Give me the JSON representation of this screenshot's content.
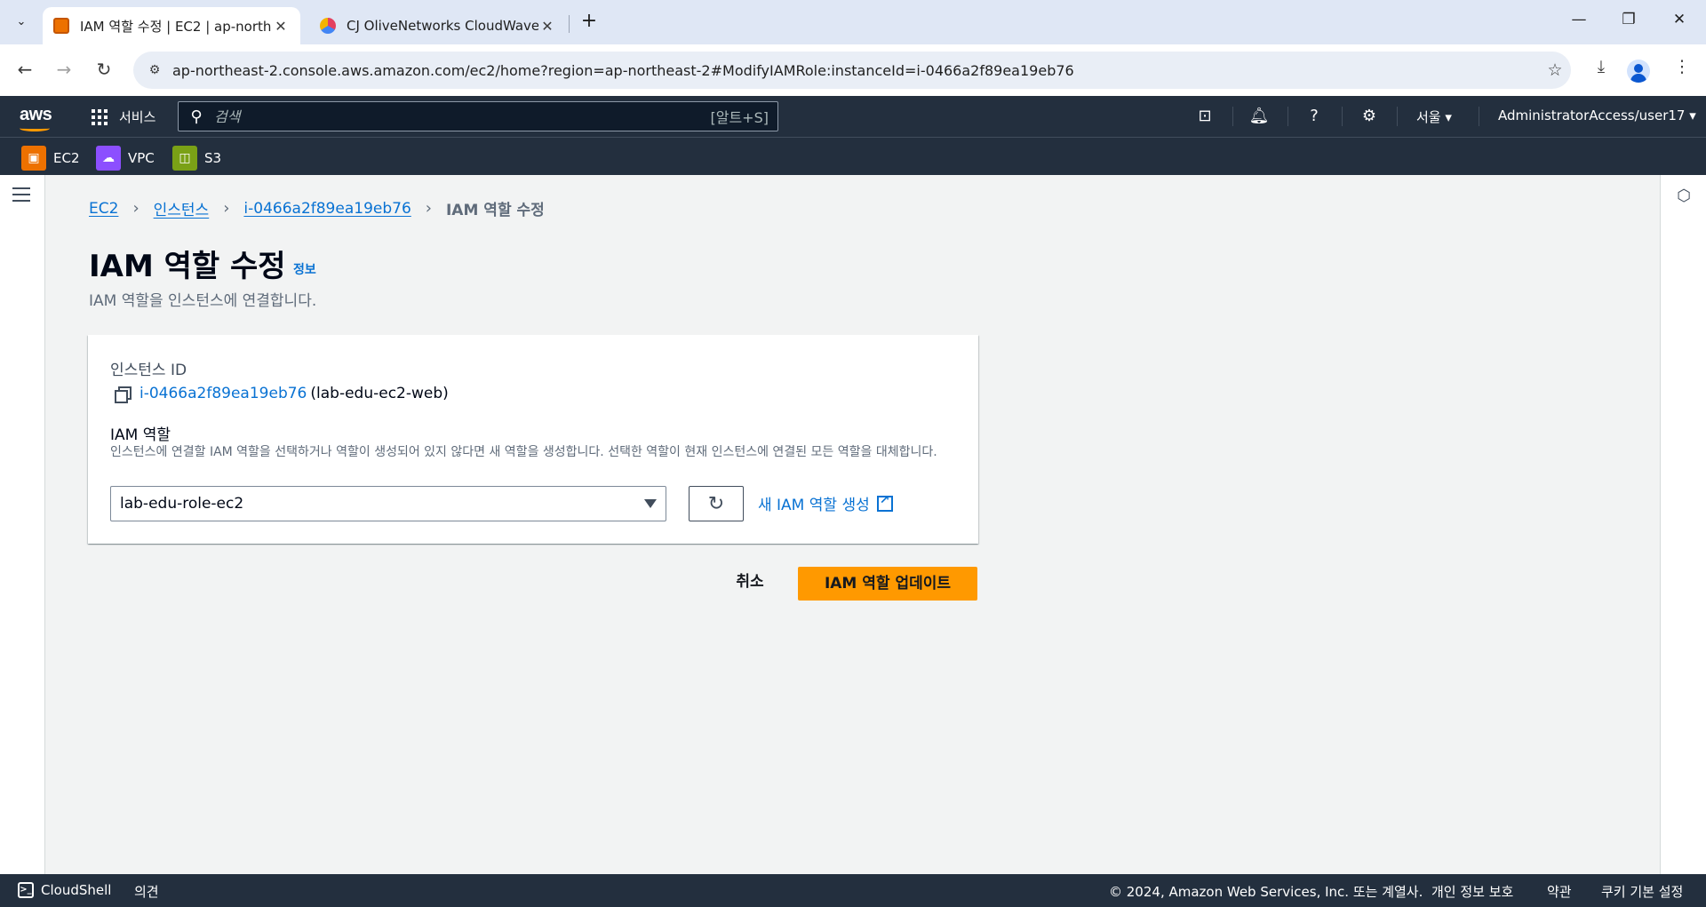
{
  "browser": {
    "tabs": [
      {
        "title": "IAM 역할 수정 | EC2 | ap-northeast-2"
      },
      {
        "title": "CJ OliveNetworks CloudWave"
      }
    ],
    "url": "ap-northeast-2.console.aws.amazon.com/ec2/home?region=ap-northeast-2#ModifyIAMRole:instanceId=i-0466a2f89ea19eb76"
  },
  "aws_header": {
    "logo": "aws",
    "services_label": "서비스",
    "search_placeholder": "검색",
    "search_shortcut": "[알트+S]",
    "region": "서울",
    "account": "AdministratorAccess/user17",
    "favorites": [
      {
        "label": "EC2",
        "color": "#ed7100"
      },
      {
        "label": "VPC",
        "color": "#8c4fff"
      },
      {
        "label": "S3",
        "color": "#7aa116"
      }
    ]
  },
  "breadcrumb": {
    "items": [
      "EC2",
      "인스턴스",
      "i-0466a2f89ea19eb76"
    ],
    "current": "IAM 역할 수정"
  },
  "page": {
    "title": "IAM 역할 수정",
    "info": "정보",
    "description": "IAM 역할을 인스턴스에 연결합니다."
  },
  "form": {
    "instance_label": "인스턴스 ID",
    "instance_id": "i-0466a2f89ea19eb76",
    "instance_name": "(lab-edu-ec2-web)",
    "role_label": "IAM 역할",
    "role_description": "인스턴스에 연결할 IAM 역할을 선택하거나 역할이 생성되어 있지 않다면 새 역할을 생성합니다. 선택한 역할이 현재 인스턴스에 연결된 모든 역할을 대체합니다.",
    "role_selected": "lab-edu-role-ec2",
    "create_role_link": "새 IAM 역할 생성",
    "cancel": "취소",
    "submit": "IAM 역할 업데이트"
  },
  "footer": {
    "cloudshell": "CloudShell",
    "feedback": "의견",
    "copyright": "© 2024, Amazon Web Services, Inc. 또는 계열사.",
    "privacy": "개인 정보 보호",
    "terms": "약관",
    "cookies": "쿠키 기본 설정"
  },
  "colors": {
    "accent": "#ff9900",
    "link": "#0972d3",
    "header_bg": "#232f3e"
  }
}
